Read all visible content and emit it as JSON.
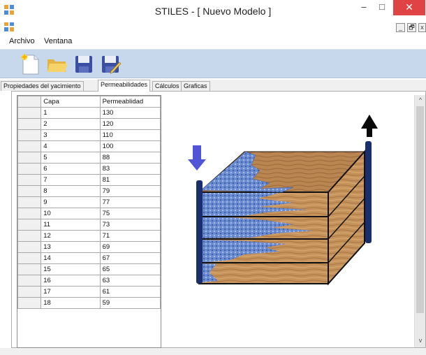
{
  "window": {
    "title": "STILES - [ Nuevo Modelo ]",
    "minimize_glyph": "–",
    "maximize_glyph": "□",
    "close_glyph": "✕"
  },
  "mdi": {
    "minimize_glyph": "_",
    "restore_glyph": "🗗",
    "close_glyph": "x"
  },
  "menu": {
    "items": [
      "Archivo",
      "Ventana"
    ]
  },
  "toolbar": {
    "buttons": [
      "new-file-icon",
      "open-folder-icon",
      "save-disk-icon",
      "save-as-disk-icon"
    ]
  },
  "tabs": [
    {
      "label": "Propiedades del yacimiento",
      "active": false
    },
    {
      "label": "Permeabilidades",
      "active": true
    },
    {
      "label": "Cálculos",
      "active": false
    },
    {
      "label": "Graficas",
      "active": false
    }
  ],
  "grid": {
    "headers": [
      "Capa",
      "Permeablidad"
    ],
    "rows": [
      [
        "1",
        "130"
      ],
      [
        "2",
        "120"
      ],
      [
        "3",
        "110"
      ],
      [
        "4",
        "100"
      ],
      [
        "5",
        "88"
      ],
      [
        "6",
        "83"
      ],
      [
        "7",
        "81"
      ],
      [
        "8",
        "79"
      ],
      [
        "9",
        "77"
      ],
      [
        "10",
        "75"
      ],
      [
        "11",
        "73"
      ],
      [
        "12",
        "71"
      ],
      [
        "13",
        "69"
      ],
      [
        "14",
        "67"
      ],
      [
        "15",
        "65"
      ],
      [
        "16",
        "63"
      ],
      [
        "17",
        "61"
      ],
      [
        "18",
        "59"
      ]
    ]
  },
  "scroll": {
    "up_glyph": "^",
    "down_glyph": "v"
  },
  "colors": {
    "wood": "#c79a63",
    "water": "#5b7fc7",
    "injector_arrow": "#4f55d6",
    "well": "#1a2e6b",
    "toolbar_bg": "#c7d8ec",
    "close_button": "#e04343"
  }
}
